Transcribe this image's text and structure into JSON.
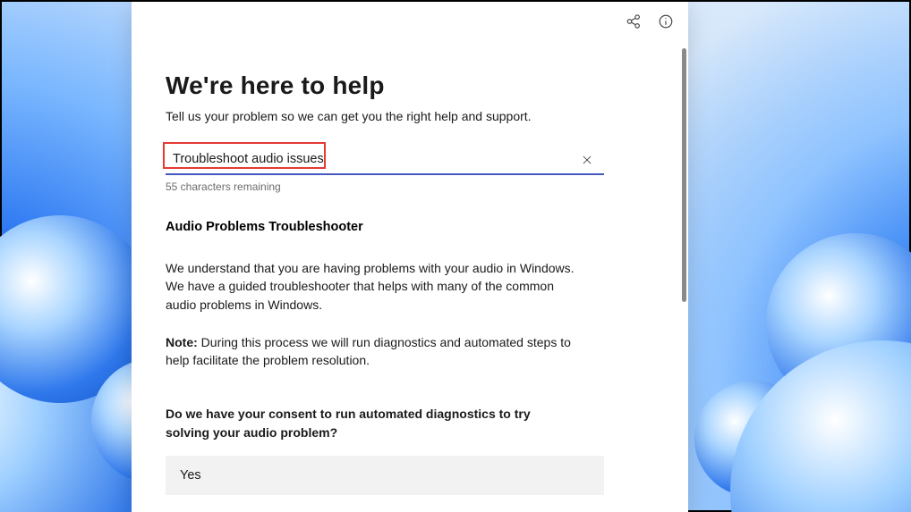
{
  "header": {
    "title": "We're here to help",
    "subtitle": "Tell us your problem so we can get you the right help and support."
  },
  "search": {
    "value": "Troubleshoot audio issues",
    "char_remaining": "55 characters remaining"
  },
  "result": {
    "title": "Audio Problems Troubleshooter",
    "intro": "We understand that you are having problems with your audio in Windows. We have a guided troubleshooter that helps with many of the common audio problems in Windows.",
    "note_label": "Note:",
    "note_body": " During this process we will run diagnostics and automated steps to help facilitate the problem resolution.",
    "consent_question": "Do we have your consent to run automated diagnostics to try solving your audio problem?",
    "options": {
      "yes": "Yes"
    }
  }
}
